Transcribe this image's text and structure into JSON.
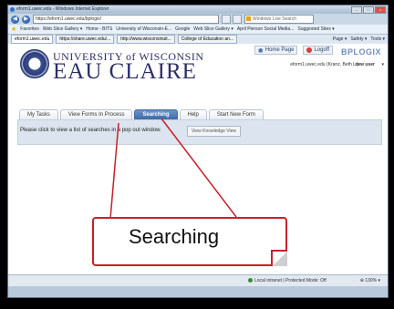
{
  "window": {
    "title": "eform1.uwec.edu - Windows Internet Explorer"
  },
  "browser": {
    "address": "https://eform1.uwec.edu/bplogix/",
    "address_bold": "uwec.edu",
    "search_placeholder": "Windows Live Search",
    "favorites_label": "Favorites",
    "favorites": [
      "Web Slice Gallery ▾",
      "Home - BITS",
      "University of Wisconsin-E...",
      "Google",
      "Web Slice Gallery ▾",
      "April Pierson Social Media...",
      "Suggested Sites ▾"
    ],
    "tabs": [
      "eform1.uwec.edu",
      "https://share.uwec.edu/...",
      "http://www.wisconsinuit...",
      "College of Education an..."
    ],
    "commands": [
      "Page ▾",
      "Safety ▾",
      "Tools ▾"
    ]
  },
  "site": {
    "university": "UNIVERSITY of WISCONSIN",
    "campus": "EAU CLAIRE",
    "home_page": "Home Page",
    "logoff": "Logoff",
    "vendor": "BPLOGIX",
    "user": "eform1.uwec.edu (Kranz, Beth L.)",
    "new_user": "new user",
    "new_user_caret": "▾"
  },
  "nav_tabs": [
    {
      "label": "My Tasks",
      "active": false
    },
    {
      "label": "View Forms In Process",
      "active": false
    },
    {
      "label": "Searching",
      "active": true
    },
    {
      "label": "Help",
      "active": false
    },
    {
      "label": "Start New Form",
      "active": false
    }
  ],
  "panel": {
    "message": "Please click to view a list of searches in a pop out window.",
    "button": "View Knowledge View"
  },
  "callout": {
    "text": "Searching",
    "border_color": "#c8202b"
  },
  "status": {
    "zone": "Local intranet | Protected Mode: Off",
    "zoom": "⊕ 130% ▾"
  }
}
